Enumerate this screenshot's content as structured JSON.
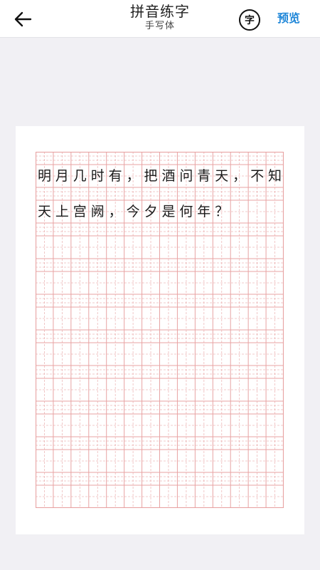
{
  "header": {
    "back_icon": "arrow-left-icon",
    "title": "拼音练字",
    "subtitle": "手写体",
    "char_button_label": "字",
    "preview_label": "预览"
  },
  "paper": {
    "grid_color": "#e8a3a3",
    "lines": [
      [
        "明",
        "月",
        "几",
        "时",
        "有",
        "，",
        "把",
        "酒",
        "问",
        "青",
        "天",
        "，",
        "不",
        "知"
      ],
      [
        "天",
        "上",
        "宫",
        "阙",
        "，",
        "今",
        "夕",
        "是",
        "何",
        "年",
        "？"
      ]
    ]
  }
}
